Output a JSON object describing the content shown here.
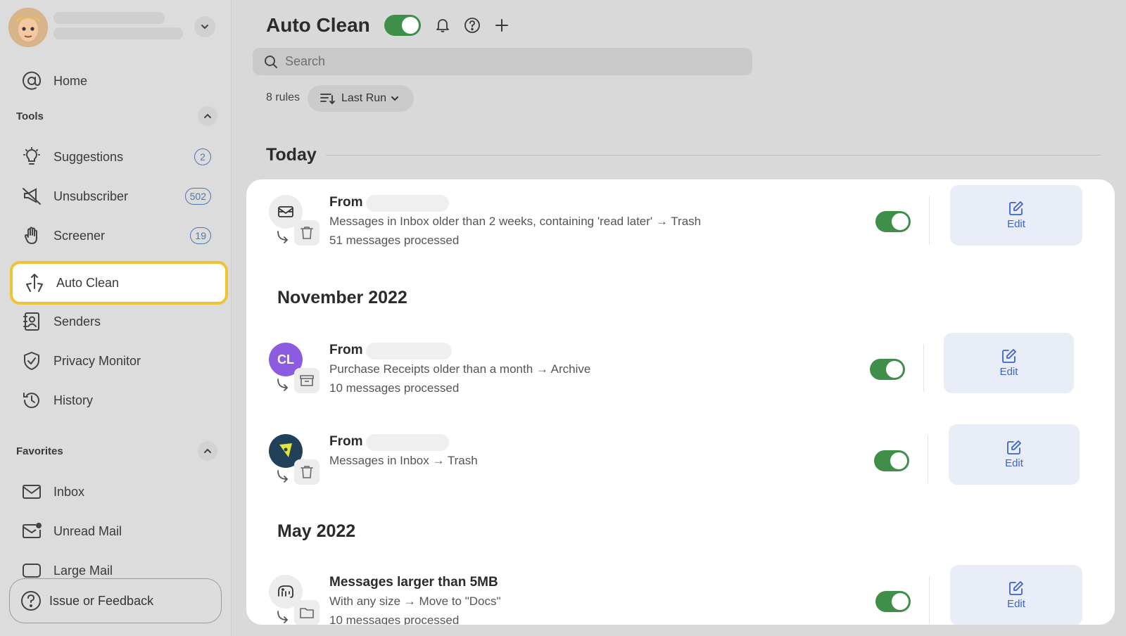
{
  "sidebar": {
    "home": "Home",
    "tools_header": "Tools",
    "tools": [
      {
        "label": "Suggestions",
        "badge": "2"
      },
      {
        "label": "Unsubscriber",
        "badge": "502"
      },
      {
        "label": "Screener",
        "badge": "19"
      },
      {
        "label": "Auto Clean"
      },
      {
        "label": "Senders"
      },
      {
        "label": "Privacy Monitor"
      },
      {
        "label": "History"
      }
    ],
    "favorites_header": "Favorites",
    "favorites": [
      {
        "label": "Inbox"
      },
      {
        "label": "Unread Mail"
      },
      {
        "label": "Large Mail"
      }
    ],
    "feedback": "Issue or Feedback"
  },
  "header": {
    "title": "Auto Clean",
    "enabled": true
  },
  "search": {
    "placeholder": "Search"
  },
  "toolbar": {
    "rules_count": "8 rules",
    "sort_label": "Last Run"
  },
  "groups": [
    {
      "title": "Today",
      "rules": [
        {
          "from": "From",
          "description": "Messages in Inbox older than 2 weeks, containing 'read later' → Trash",
          "processed": "51 messages processed",
          "enabled": true,
          "edit": "Edit"
        }
      ]
    },
    {
      "title": "November 2022",
      "rules": [
        {
          "avatar_initials": "CL",
          "from": "From",
          "description": "Purchase Receipts older than a month → Archive",
          "processed": "10 messages processed",
          "enabled": true,
          "edit": "Edit"
        },
        {
          "from": "From",
          "description": "Messages in Inbox → Trash",
          "enabled": true,
          "edit": "Edit"
        }
      ]
    },
    {
      "title": "May 2022",
      "rules": [
        {
          "from": "Messages larger than 5MB",
          "description": "With any size → Move to \"Docs\"",
          "processed": "10 messages processed",
          "enabled": true,
          "edit": "Edit"
        }
      ]
    }
  ],
  "colors": {
    "toggle_on": "#3f8f4a",
    "active_border": "#f2c230",
    "edit_bg": "#e9edf7",
    "edit_text": "#3c63c9",
    "badge": "#4b78b0"
  }
}
